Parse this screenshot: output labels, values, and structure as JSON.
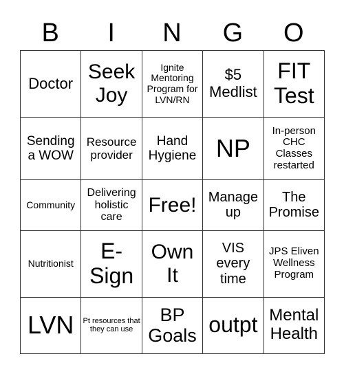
{
  "header": [
    "B",
    "I",
    "N",
    "G",
    "O"
  ],
  "cells": [
    [
      "Doctor",
      "Seek Joy",
      "Ignite Mentoring Program for LVN/RN",
      "$5 Medlist",
      "FIT Test"
    ],
    [
      "Sending a WOW",
      "Resource provider",
      "Hand Hygiene",
      "NP",
      "In-person CHC Classes restarted"
    ],
    [
      "Community",
      "Delivering holistic care",
      "Free!",
      "Manage up",
      "The Promise"
    ],
    [
      "Nutritionist",
      "E-Sign",
      "Own It",
      "VIS every time",
      "JPS Eliven Wellness Program"
    ],
    [
      "LVN",
      "Pt resources that they can use",
      "BP Goals",
      "outpt",
      "Mental Health"
    ]
  ]
}
